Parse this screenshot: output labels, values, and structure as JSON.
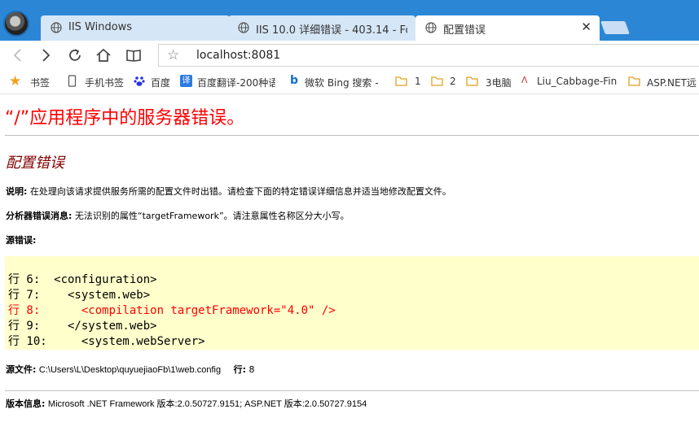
{
  "tabs": [
    {
      "title": "IIS Windows"
    },
    {
      "title": "IIS 10.0 详细错误 - 403.14 - For"
    },
    {
      "title": "配置错误",
      "active": true
    }
  ],
  "address": {
    "url": "localhost:8081"
  },
  "bookmarks": [
    {
      "label": "书签",
      "icon": "star-icon"
    },
    {
      "label": "手机书签",
      "icon": "phone-icon"
    },
    {
      "label": "百度",
      "icon": "baidu-icon"
    },
    {
      "label": "百度翻译-200种语",
      "icon": "translate-icon"
    },
    {
      "label": "微软 Bing 搜索 -",
      "icon": "bing-icon"
    },
    {
      "label": "1",
      "icon": "folder-icon"
    },
    {
      "label": "2",
      "icon": "folder-icon"
    },
    {
      "label": "3电脑",
      "icon": "folder-icon"
    },
    {
      "label": "Liu_Cabbage-Fin",
      "icon": "csdn-icon"
    },
    {
      "label": "ASP.NET远",
      "icon": "folder-icon"
    }
  ],
  "page": {
    "heading": "“/”应用程序中的服务器错误。",
    "subheading": "配置错误",
    "desc_label": "说明:",
    "desc_text": "在处理向该请求提供服务所需的配置文件时出错。请检查下面的特定错误详细信息并适当地修改配置文件。",
    "parser_label": "分析器错误消息:",
    "parser_text": "无法识别的属性“targetFramework”。请注意属性名称区分大小写。",
    "source_error_label": "源错误:",
    "code_lines": [
      {
        "text": "行 6:  <configuration>",
        "error": false
      },
      {
        "text": "行 7:    <system.web>",
        "error": false
      },
      {
        "text": "行 8:      <compilation targetFramework=\"4.0\" />",
        "error": true
      },
      {
        "text": "行 9:    </system.web>",
        "error": false
      },
      {
        "text": "行 10:     <system.webServer>",
        "error": false
      }
    ],
    "source_file_label": "源文件:",
    "source_file_path": "C:\\Users\\L\\Desktop\\quyuejiaoFb\\1\\web.config",
    "line_label": "行:",
    "line_number": "8",
    "version_label": "版本信息:",
    "version_text": "Microsoft .NET Framework 版本:2.0.50727.9151; ASP.NET 版本:2.0.50727.9154"
  },
  "colors": {
    "chrome": "#2b87d6",
    "heading": "#ff0000",
    "subheading": "#800000",
    "code_bg": "#ffffcc"
  }
}
